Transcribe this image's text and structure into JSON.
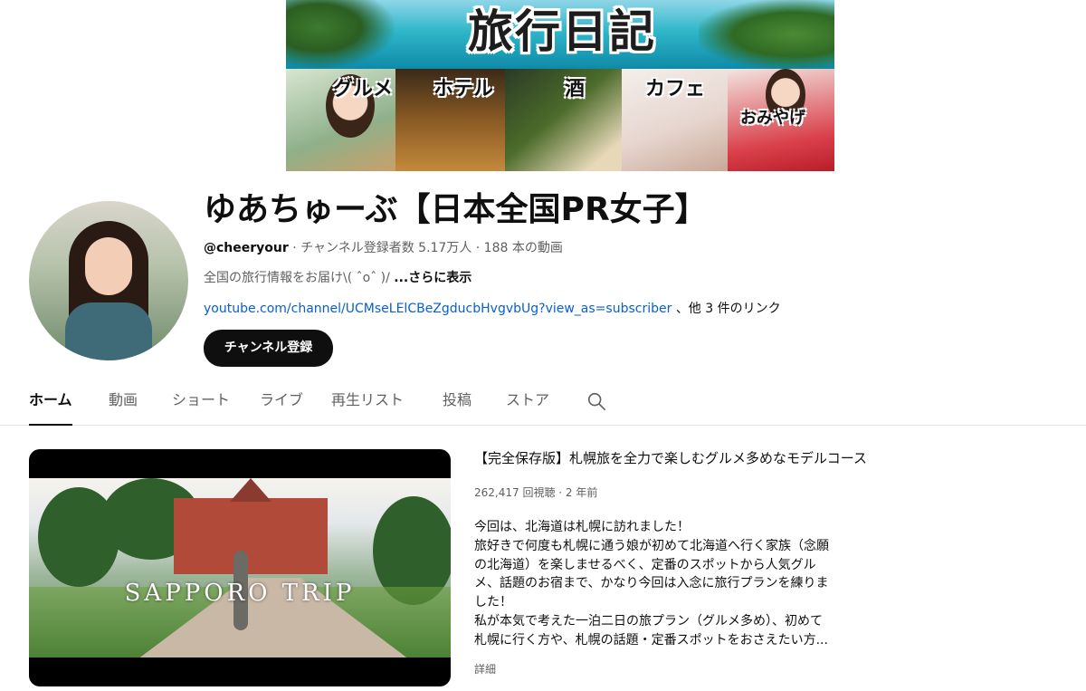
{
  "banner": {
    "title": "旅行日記",
    "panels": [
      {
        "label": "グルメ"
      },
      {
        "label": "ホテル"
      },
      {
        "label": "酒"
      },
      {
        "label": "カフェ"
      },
      {
        "label": "おみやげ"
      }
    ]
  },
  "channel": {
    "name": "ゆあちゅーぶ【日本全国PR女子】",
    "handle": "@cheeryour",
    "meta_rest": " · チャンネル登録者数 5.17万人 · 188 本の動画",
    "description": "全国の旅行情報をお届け\\( ˆoˆ )/ ",
    "more_label": "...さらに表示",
    "link_url": "youtube.com/channel/UCMseLElCBeZgducbHvgvbUg?view_as=subscriber",
    "link_other": "、他 3 件のリンク",
    "subscribe_label": "チャンネル登録"
  },
  "tabs": [
    {
      "label": "ホーム",
      "active": true
    },
    {
      "label": "動画"
    },
    {
      "label": "ショート"
    },
    {
      "label": "ライブ"
    },
    {
      "label": "再生リスト"
    },
    {
      "label": "投稿"
    },
    {
      "label": "ストア"
    }
  ],
  "featured_video": {
    "thumbnail_overlay": "SAPPORO TRIP",
    "title": "【完全保存版】札幌旅を全力で楽しむグルメ多めなモデルコース",
    "meta": "262,417 回視聴 · 2 年前",
    "description_lines": [
      "今回は、北海道は札幌に訪れました！",
      "旅好きで何度も札幌に通う娘が初めて北海道へ行く家族（念願",
      "の北海道）を楽しませるべく、定番のスポットから人気グル",
      "メ、話題のお宿まで、かなり今回は入念に旅行プランを練りま",
      "した！",
      "私が本気で考えた一泊二日の旅プラン（グルメ多め）、初めて",
      "札幌に行く方や、札幌の話題・定番スポットをおさえたい方..."
    ],
    "details_label": "詳細"
  }
}
